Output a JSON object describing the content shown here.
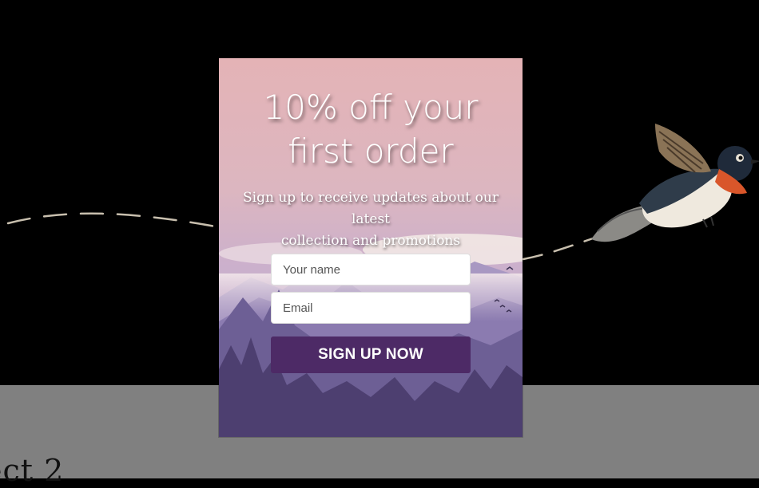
{
  "page": {
    "background_heading": "ect 2"
  },
  "popup": {
    "title_line1": "10% off your",
    "title_line2": "first order",
    "subtitle_line1": "Sign up to receive updates about our latest",
    "subtitle_line2": "collection and promotions",
    "name_placeholder": "Your name",
    "email_placeholder": "Email",
    "cta_label": "SIGN UP NOW",
    "colors": {
      "cta_bg": "#4d2a66",
      "sky_top": "#e2b3b7",
      "sky_mid": "#c9a8c5",
      "mountains": "#8d7db0",
      "forest": "#4b3f6b"
    }
  },
  "icons": {
    "bird": "bird-illustration",
    "flight_path": "dashed-flight-path"
  }
}
